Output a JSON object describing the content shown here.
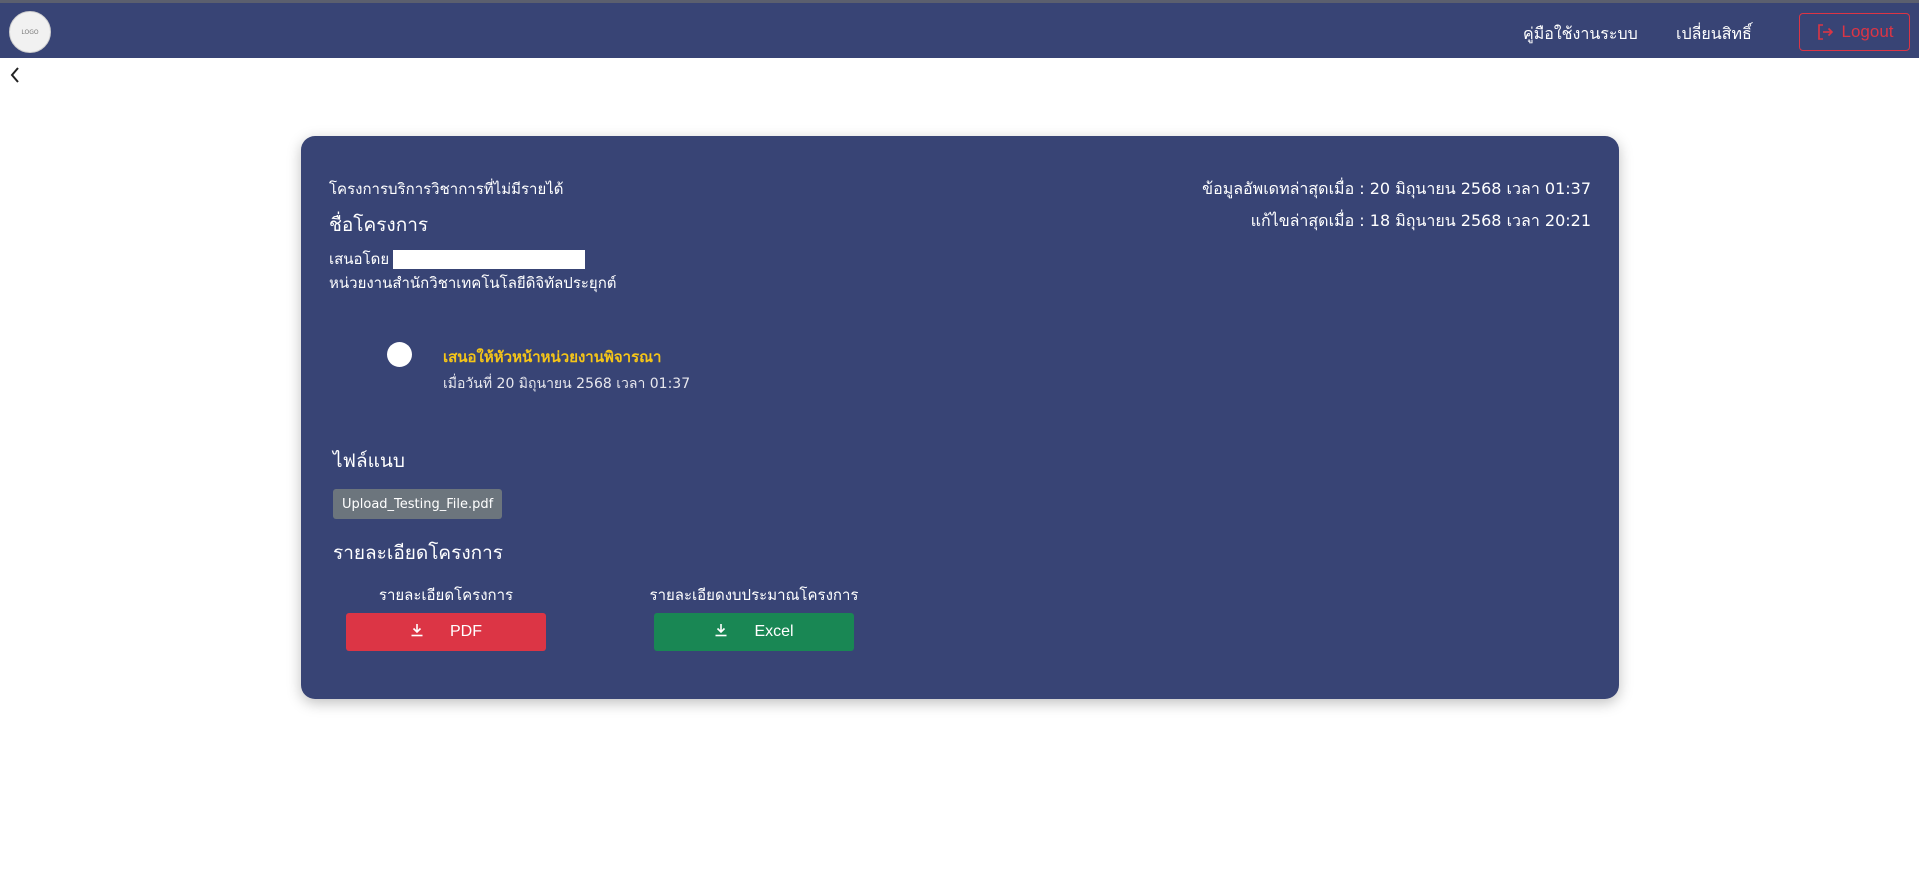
{
  "header": {
    "logo_text": "LOGO",
    "nav": {
      "manual_label": "คู่มือใช้งานระบบ",
      "switch_role_label": "เปลี่ยนสิทธิ์",
      "logout_label": "Logout"
    },
    "colors": {
      "bar": "#384475",
      "logout": "#dc3545"
    }
  },
  "icons": {
    "back": "chevron-left-icon",
    "logout": "logout-icon",
    "download": "download-icon"
  },
  "project": {
    "category": "โครงการบริการวิชาการที่ไม่มีรายได้",
    "name_label": "ชื่อโครงการ",
    "proposed_by_label": "เสนอโดย",
    "unit": "หน่วยงานสำนักวิชาเทคโนโลยีดิจิทัลประยุกต์",
    "updated_at": "ข้อมูลอัพเดทล่าสุดเมื่อ : 20 มิถุนายน 2568 เวลา 01:37",
    "edited_at": "แก้ไขล่าสุดเมื่อ : 18 มิถุนายน 2568 เวลา 20:21"
  },
  "timeline": {
    "status": "เสนอให้หัวหน้าหน่วยงานพิจารณา",
    "date": "เมื่อวันที่ 20 มิถุนายน 2568 เวลา 01:37"
  },
  "attachments": {
    "heading": "ไฟล์แนบ",
    "files": [
      "Upload_Testing_File.pdf"
    ]
  },
  "details": {
    "heading": "รายละเอียดโครงการ",
    "project_detail_label": "รายละเอียดโครงการ",
    "budget_detail_label": "รายละเอียดงบประมาณโครงการ",
    "pdf_button": "PDF",
    "excel_button": "Excel",
    "colors": {
      "pdf": "#dc3545",
      "excel": "#198754",
      "status": "#f5c518"
    }
  }
}
